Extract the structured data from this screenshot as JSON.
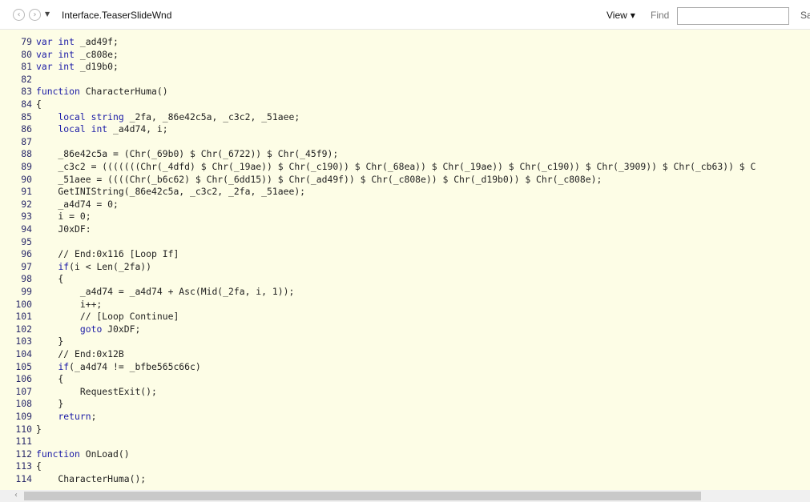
{
  "toolbar": {
    "back_icon": "‹",
    "forward_icon": "›",
    "dropdown_icon": "▼",
    "title": "Interface.TeaserSlideWnd",
    "view_label": "View",
    "view_chevron": "▼",
    "find_label": "Find",
    "find_value": "",
    "save_label": "Sa"
  },
  "code": {
    "lines": [
      {
        "n": "79",
        "f": "",
        "t": "var int _ad49f;"
      },
      {
        "n": "80",
        "f": "",
        "t": "var int _c808e;"
      },
      {
        "n": "81",
        "f": "",
        "t": "var int _d19b0;"
      },
      {
        "n": "82",
        "f": "",
        "t": ""
      },
      {
        "n": "83",
        "f": "",
        "t": "function CharacterHuma()"
      },
      {
        "n": "84",
        "f": "",
        "t": "{"
      },
      {
        "n": "85",
        "f": "",
        "t": "    local string _2fa, _86e42c5a, _c3c2, _51aee;"
      },
      {
        "n": "86",
        "f": "",
        "t": "    local int _a4d74, i;"
      },
      {
        "n": "87",
        "f": "",
        "t": ""
      },
      {
        "n": "88",
        "f": "",
        "t": "    _86e42c5a = (Chr(_69b0) $ Chr(_6722)) $ Chr(_45f9);"
      },
      {
        "n": "89",
        "f": "",
        "t": "    _c3c2 = (((((((Chr(_4dfd) $ Chr(_19ae)) $ Chr(_c190)) $ Chr(_68ea)) $ Chr(_19ae)) $ Chr(_c190)) $ Chr(_3909)) $ Chr(_cb63)) $ C"
      },
      {
        "n": "90",
        "f": "",
        "t": "    _51aee = ((((Chr(_b6c62) $ Chr(_6dd15)) $ Chr(_ad49f)) $ Chr(_c808e)) $ Chr(_d19b0)) $ Chr(_c808e);"
      },
      {
        "n": "91",
        "f": "",
        "t": "    GetINIString(_86e42c5a, _c3c2, _2fa, _51aee);"
      },
      {
        "n": "92",
        "f": "",
        "t": "    _a4d74 = 0;"
      },
      {
        "n": "93",
        "f": "",
        "t": "    i = 0;"
      },
      {
        "n": "94",
        "f": "",
        "t": "    J0xDF:"
      },
      {
        "n": "95",
        "f": "",
        "t": ""
      },
      {
        "n": "96",
        "f": "",
        "t": "    // End:0x116 [Loop If]"
      },
      {
        "n": "97",
        "f": "",
        "t": "    if(i < Len(_2fa))"
      },
      {
        "n": "98",
        "f": "",
        "t": "    {"
      },
      {
        "n": "99",
        "f": "",
        "t": "        _a4d74 = _a4d74 + Asc(Mid(_2fa, i, 1));"
      },
      {
        "n": "100",
        "f": "",
        "t": "        i++;"
      },
      {
        "n": "101",
        "f": "",
        "t": "        // [Loop Continue]"
      },
      {
        "n": "102",
        "f": "",
        "t": "        goto J0xDF;"
      },
      {
        "n": "103",
        "f": "",
        "t": "    }"
      },
      {
        "n": "104",
        "f": "",
        "t": "    // End:0x12B"
      },
      {
        "n": "105",
        "f": "",
        "t": "    if(_a4d74 != _bfbe565c66c)"
      },
      {
        "n": "106",
        "f": "",
        "t": "    {"
      },
      {
        "n": "107",
        "f": "",
        "t": "        RequestExit();"
      },
      {
        "n": "108",
        "f": "",
        "t": "    }"
      },
      {
        "n": "109",
        "f": "",
        "t": "    return;"
      },
      {
        "n": "110",
        "f": "",
        "t": "}"
      },
      {
        "n": "111",
        "f": "",
        "t": ""
      },
      {
        "n": "112",
        "f": "",
        "t": "function OnLoad()"
      },
      {
        "n": "113",
        "f": "",
        "t": "{"
      },
      {
        "n": "114",
        "f": "",
        "t": "    CharacterHuma();"
      }
    ]
  },
  "scrollbar": {
    "left_arrow_icon": "‹"
  },
  "colors": {
    "background": "#fdfde6",
    "line_number": "#2b2b6b",
    "keyword": "#1a1aa6",
    "text": "#222222"
  }
}
